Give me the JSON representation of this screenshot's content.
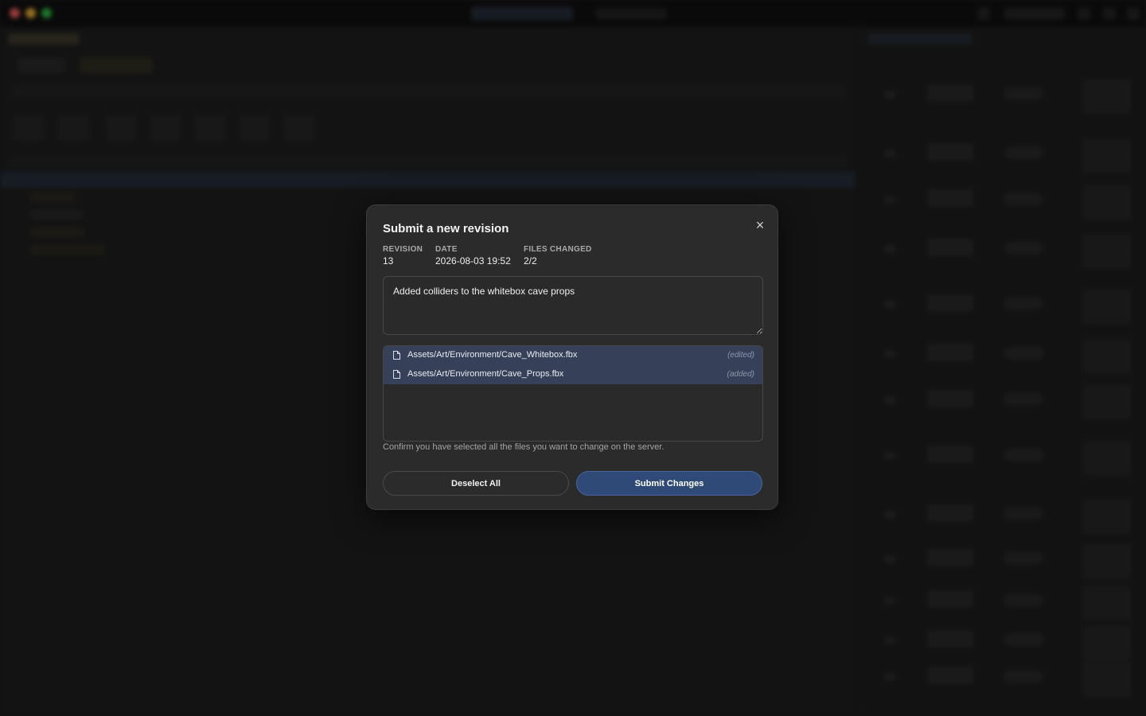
{
  "modal": {
    "title": "Submit a new revision",
    "close_icon": "×",
    "meta": {
      "revision_label": "REVISION",
      "revision_value": "13",
      "date_label": "DATE",
      "date_value": "2026-08-03 19:52",
      "files_label": "FILES CHANGED",
      "files_value": "2/2"
    },
    "message": "Added colliders to the whitebox cave props",
    "files": [
      {
        "path": "Assets/Art/Environment/Cave_Whitebox.fbx",
        "status": "(edited)",
        "icon": "file-icon"
      },
      {
        "path": "Assets/Art/Environment/Cave_Props.fbx",
        "status": "(added)",
        "icon": "file-icon"
      }
    ],
    "hint": "Confirm you have selected all the files you want to change on the server.",
    "deselect_label": "Deselect All",
    "submit_label": "Submit Changes"
  },
  "colors": {
    "modal_bg": "#2b2b2b",
    "selected_row": "#364159",
    "primary_button": "#2f4a76"
  }
}
